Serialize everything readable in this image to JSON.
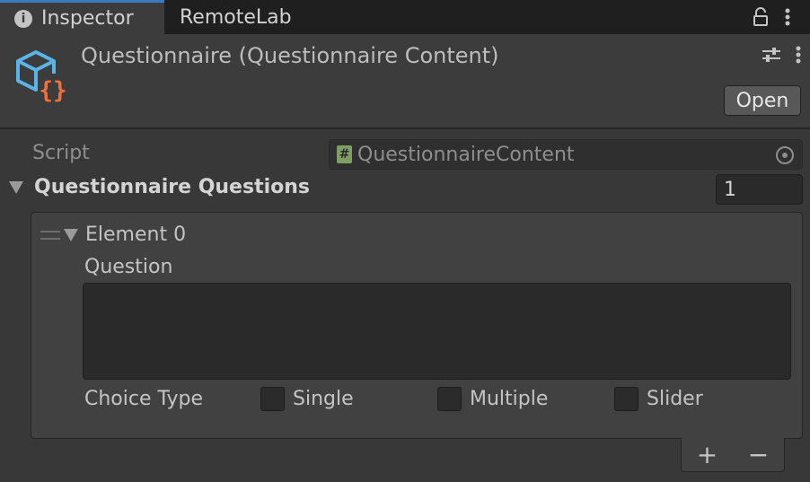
{
  "tabs": {
    "inspector": "Inspector",
    "remotelab": "RemoteLab"
  },
  "header": {
    "title": "Questionnaire (Questionnaire Content)",
    "open_label": "Open"
  },
  "script_field": {
    "label": "Script",
    "value": "QuestionnaireContent"
  },
  "questions": {
    "label": "Questionnaire Questions",
    "size": "1",
    "element": {
      "label": "Element 0",
      "question_label": "Question",
      "question_value": "",
      "choice_type_label": "Choice Type",
      "choices": [
        "Single",
        "Multiple",
        "Slider"
      ]
    }
  },
  "footer": {
    "add": "+",
    "remove": "−"
  },
  "colors": {
    "tab_accent": "#3a79bb",
    "icon_blue": "#5ab4e6",
    "icon_orange": "#f0703c",
    "script_hash": "#7f9f62"
  },
  "icons": [
    "info-icon",
    "lock-icon",
    "more-vertical-icon",
    "script-component-icon",
    "sliders-icon",
    "hash-icon",
    "object-picker-icon",
    "fold-triangle-icon",
    "drag-handle-icon"
  ]
}
